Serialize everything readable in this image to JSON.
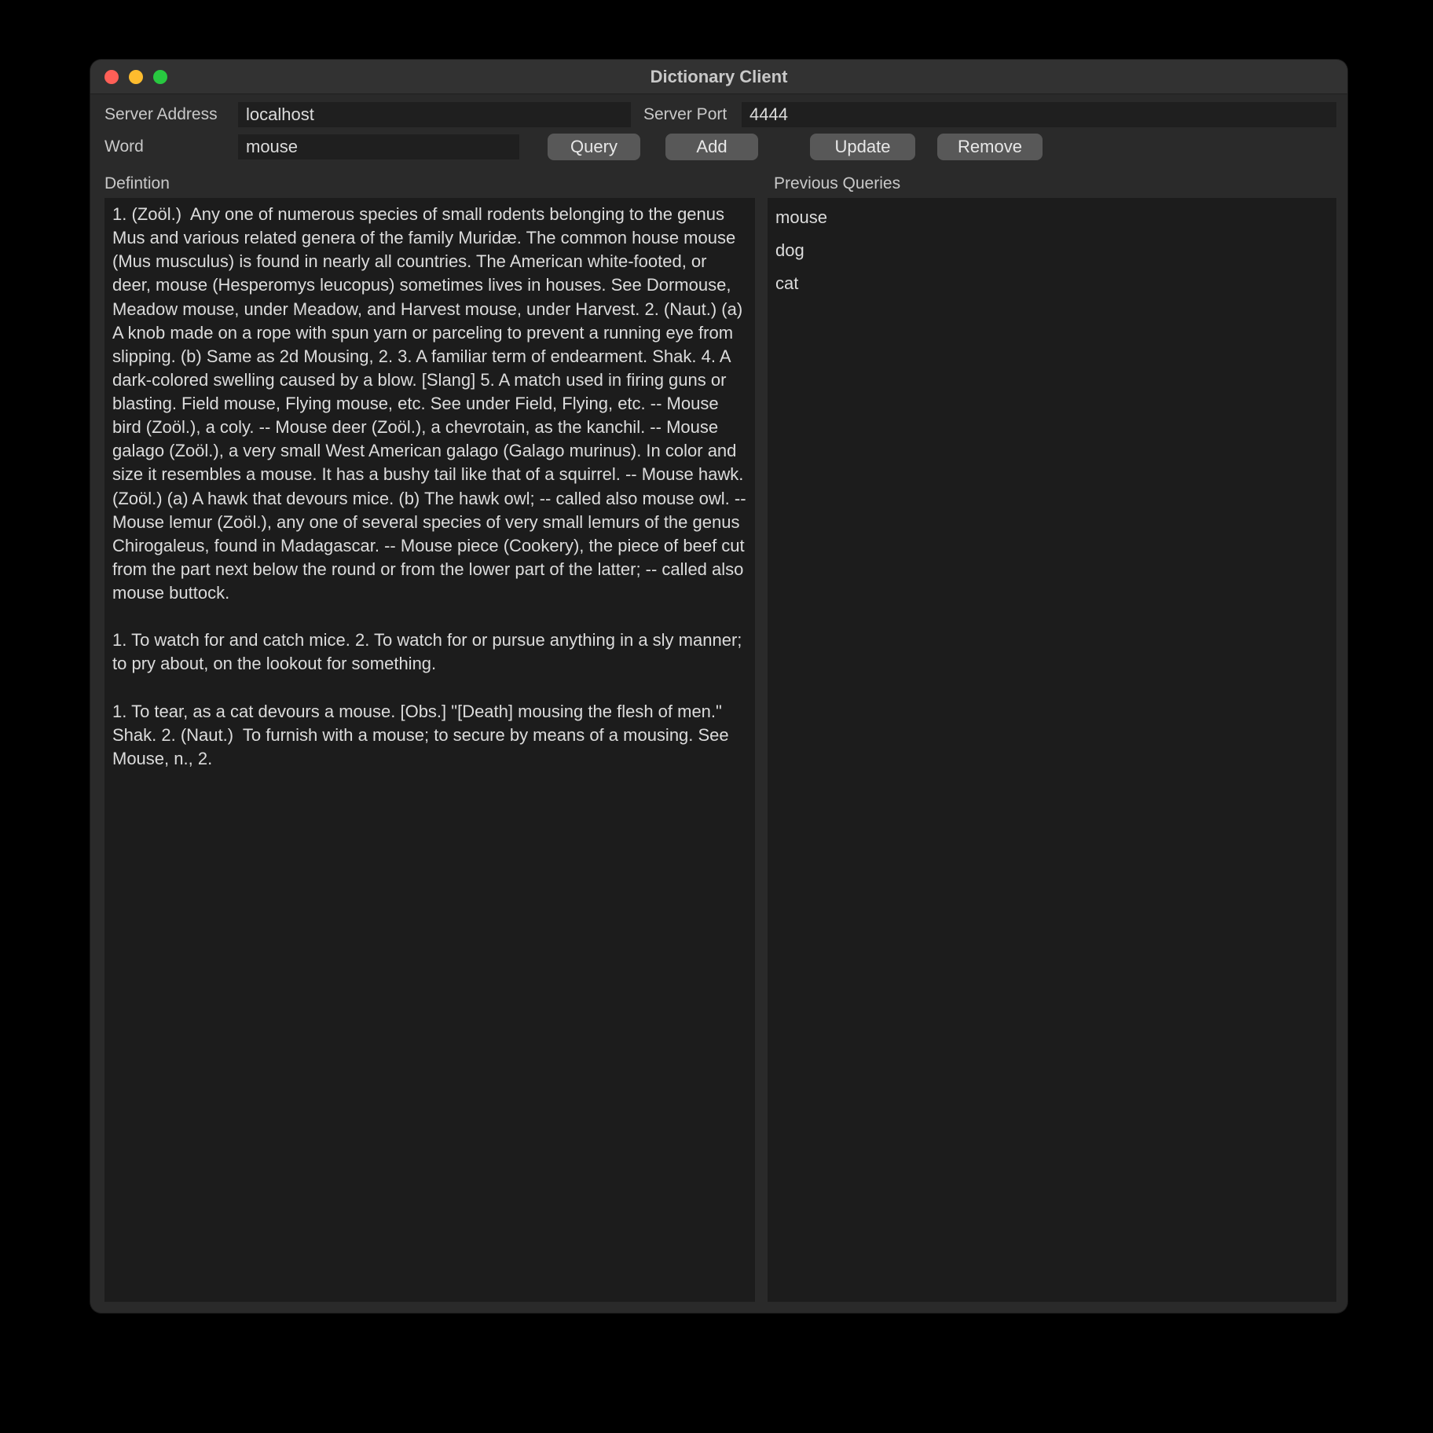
{
  "window": {
    "title": "Dictionary Client"
  },
  "labels": {
    "server_address": "Server Address",
    "server_port": "Server Port",
    "word": "Word",
    "definition": "Defintion",
    "previous_queries": "Previous Queries"
  },
  "inputs": {
    "server_address": "localhost",
    "server_port": "4444",
    "word": "mouse"
  },
  "buttons": {
    "query": "Query",
    "add": "Add",
    "update": "Update",
    "remove": "Remove"
  },
  "definition_text": "1. (Zoöl.)  Any one of numerous species of small rodents belonging to the genus Mus and various related genera of the family Muridæ. The common house mouse (Mus musculus) is found in nearly all countries. The American white-footed, or deer, mouse (Hesperomys leucopus) sometimes lives in houses. See Dormouse, Meadow mouse, under Meadow, and Harvest mouse, under Harvest. 2. (Naut.) (a) A knob made on a rope with spun yarn or parceling to prevent a running eye from slipping. (b) Same as 2d Mousing, 2. 3. A familiar term of endearment. Shak. 4. A dark-colored swelling caused by a blow. [Slang] 5. A match used in firing guns or blasting. Field mouse, Flying mouse, etc. See under Field, Flying, etc. -- Mouse bird (Zoöl.), a coly. -- Mouse deer (Zoöl.), a chevrotain, as the kanchil. -- Mouse galago (Zoöl.), a very small West American galago (Galago murinus). In color and size it resembles a mouse. It has a bushy tail like that of a squirrel. -- Mouse hawk. (Zoöl.) (a) A hawk that devours mice. (b) The hawk owl; -- called also mouse owl. -- Mouse lemur (Zoöl.), any one of several species of very small lemurs of the genus Chirogaleus, found in Madagascar. -- Mouse piece (Cookery), the piece of beef cut from the part next below the round or from the lower part of the latter; -- called also mouse buttock.\n\n1. To watch for and catch mice. 2. To watch for or pursue anything in a sly manner; to pry about, on the lookout for something.\n\n1. To tear, as a cat devours a mouse. [Obs.] \"[Death] mousing the flesh of men.\" Shak. 2. (Naut.)  To furnish with a mouse; to secure by means of a mousing. See Mouse, n., 2.",
  "previous_queries": [
    "mouse",
    "dog",
    "cat"
  ]
}
